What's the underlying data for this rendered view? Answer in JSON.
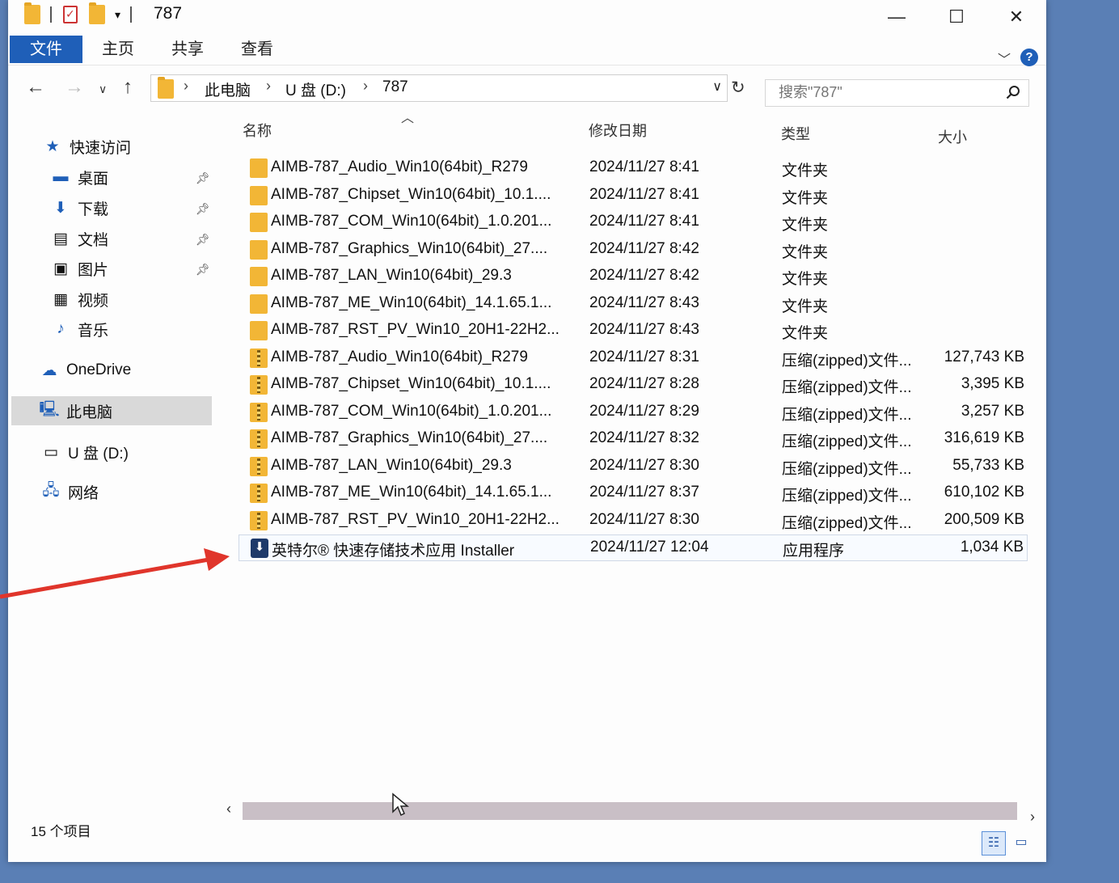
{
  "window": {
    "title": "787",
    "controls": [
      "minimize",
      "maximize",
      "close"
    ]
  },
  "ribbon": {
    "tabs": [
      {
        "label": "文件",
        "active": true
      },
      {
        "label": "主页"
      },
      {
        "label": "共享"
      },
      {
        "label": "查看"
      }
    ]
  },
  "address": {
    "crumbs": [
      "此电脑",
      "U 盘 (D:)",
      "787"
    ]
  },
  "search": {
    "placeholder": "搜索\"787\""
  },
  "nav": {
    "quick_access": "快速访问",
    "items": [
      {
        "label": "桌面",
        "icon": "desktop-icon",
        "pinned": true
      },
      {
        "label": "下载",
        "icon": "download-icon",
        "pinned": true
      },
      {
        "label": "文档",
        "icon": "document-icon",
        "pinned": true
      },
      {
        "label": "图片",
        "icon": "picture-icon",
        "pinned": true
      },
      {
        "label": "视频",
        "icon": "video-icon",
        "pinned": false
      },
      {
        "label": "音乐",
        "icon": "music-icon",
        "pinned": false
      }
    ],
    "onedrive": "OneDrive",
    "this_pc": "此电脑",
    "usb": "U 盘 (D:)",
    "network": "网络"
  },
  "columns": {
    "name": "名称",
    "modified": "修改日期",
    "type": "类型",
    "size": "大小"
  },
  "files": [
    {
      "icon": "folder",
      "name": "AIMB-787_Audio_Win10(64bit)_R279",
      "date": "2024/11/27 8:41",
      "type": "文件夹",
      "size": ""
    },
    {
      "icon": "folder",
      "name": "AIMB-787_Chipset_Win10(64bit)_10.1....",
      "date": "2024/11/27 8:41",
      "type": "文件夹",
      "size": ""
    },
    {
      "icon": "folder",
      "name": "AIMB-787_COM_Win10(64bit)_1.0.201...",
      "date": "2024/11/27 8:41",
      "type": "文件夹",
      "size": ""
    },
    {
      "icon": "folder",
      "name": "AIMB-787_Graphics_Win10(64bit)_27....",
      "date": "2024/11/27 8:42",
      "type": "文件夹",
      "size": ""
    },
    {
      "icon": "folder",
      "name": "AIMB-787_LAN_Win10(64bit)_29.3",
      "date": "2024/11/27 8:42",
      "type": "文件夹",
      "size": ""
    },
    {
      "icon": "folder",
      "name": "AIMB-787_ME_Win10(64bit)_14.1.65.1...",
      "date": "2024/11/27 8:43",
      "type": "文件夹",
      "size": ""
    },
    {
      "icon": "folder",
      "name": "AIMB-787_RST_PV_Win10_20H1-22H2...",
      "date": "2024/11/27 8:43",
      "type": "文件夹",
      "size": ""
    },
    {
      "icon": "zip",
      "name": "AIMB-787_Audio_Win10(64bit)_R279",
      "date": "2024/11/27 8:31",
      "type": "压缩(zipped)文件...",
      "size": "127,743 KB"
    },
    {
      "icon": "zip",
      "name": "AIMB-787_Chipset_Win10(64bit)_10.1....",
      "date": "2024/11/27 8:28",
      "type": "压缩(zipped)文件...",
      "size": "3,395 KB"
    },
    {
      "icon": "zip",
      "name": "AIMB-787_COM_Win10(64bit)_1.0.201...",
      "date": "2024/11/27 8:29",
      "type": "压缩(zipped)文件...",
      "size": "3,257 KB"
    },
    {
      "icon": "zip",
      "name": "AIMB-787_Graphics_Win10(64bit)_27....",
      "date": "2024/11/27 8:32",
      "type": "压缩(zipped)文件...",
      "size": "316,619 KB"
    },
    {
      "icon": "zip",
      "name": "AIMB-787_LAN_Win10(64bit)_29.3",
      "date": "2024/11/27 8:30",
      "type": "压缩(zipped)文件...",
      "size": "55,733 KB"
    },
    {
      "icon": "zip",
      "name": "AIMB-787_ME_Win10(64bit)_14.1.65.1...",
      "date": "2024/11/27 8:37",
      "type": "压缩(zipped)文件...",
      "size": "610,102 KB"
    },
    {
      "icon": "zip",
      "name": "AIMB-787_RST_PV_Win10_20H1-22H2...",
      "date": "2024/11/27 8:30",
      "type": "压缩(zipped)文件...",
      "size": "200,509 KB"
    },
    {
      "icon": "app",
      "name": "英特尔® 快速存储技术应用 Installer",
      "date": "2024/11/27 12:04",
      "type": "应用程序",
      "size": "1,034 KB",
      "selected": true
    }
  ],
  "status": {
    "item_count": "15 个项目"
  },
  "colors": {
    "accent": "#1f5fb8",
    "folder": "#f2b636",
    "annotation_arrow": "#e0352b"
  }
}
